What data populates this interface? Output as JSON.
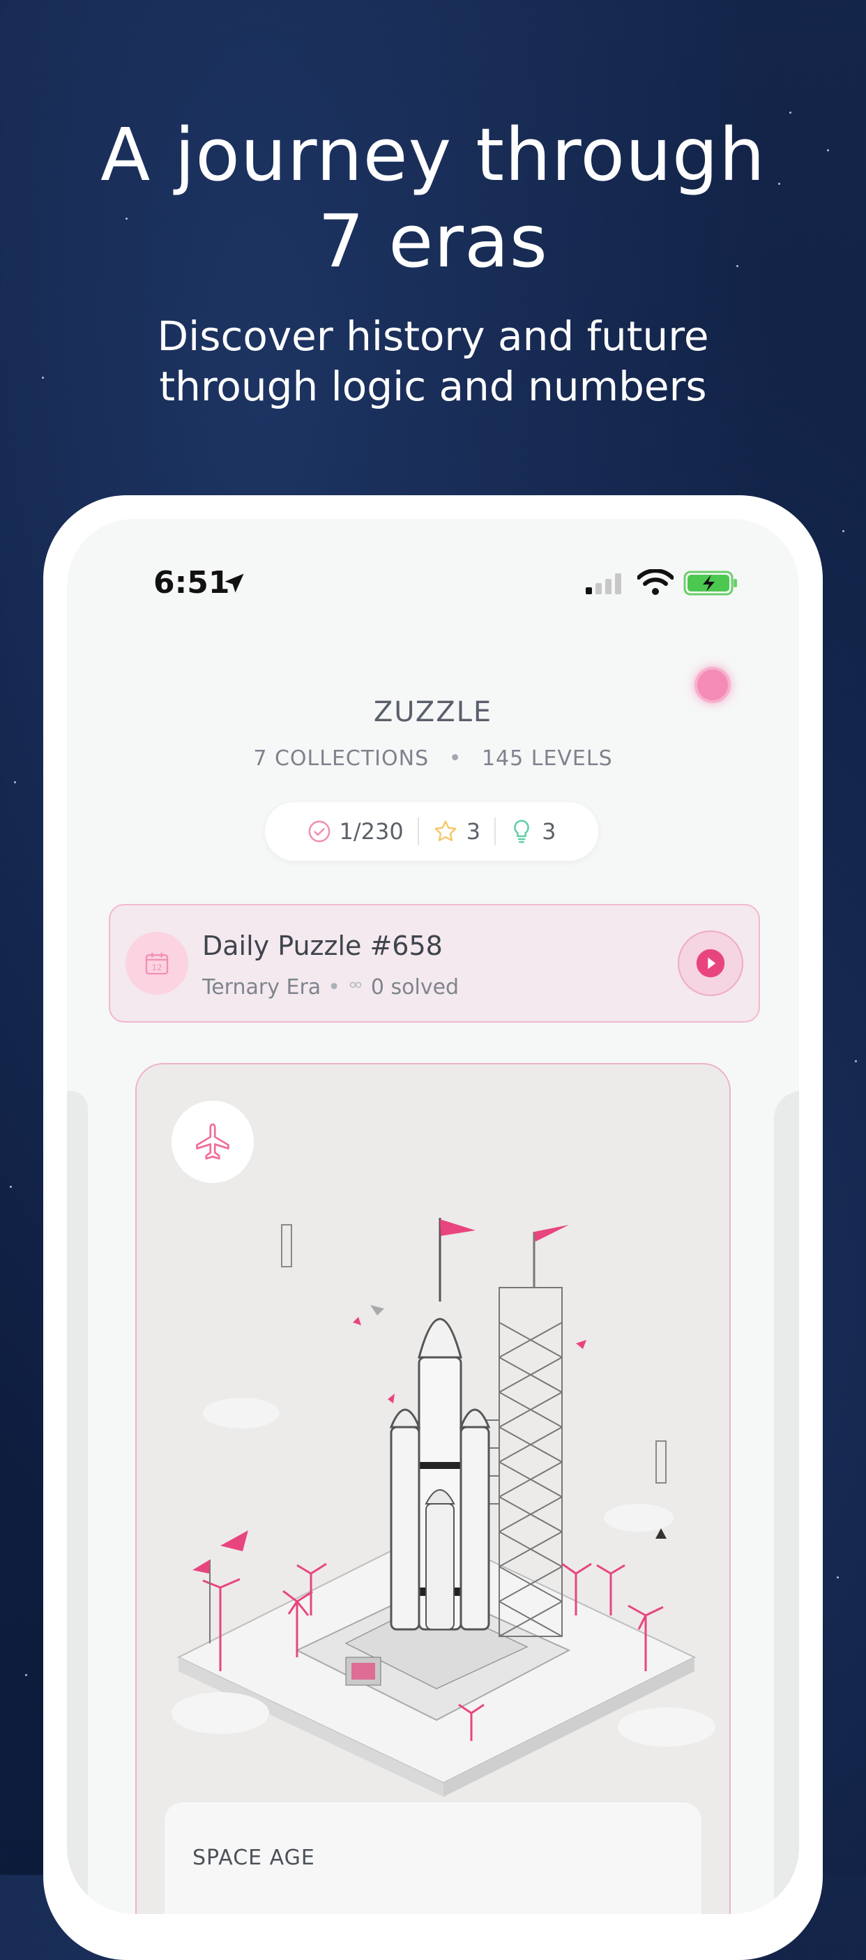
{
  "headline": {
    "line1": "A journey through",
    "line2": "7 eras"
  },
  "subheadline": {
    "line1": "Discover history and future",
    "line2": "through logic and numbers"
  },
  "status_bar": {
    "time": "6:51"
  },
  "app": {
    "title": "ZUZZLE",
    "collections": "7 COLLECTIONS",
    "levels": "145 LEVELS"
  },
  "stats": {
    "progress": "1/230",
    "stars": "3",
    "hints": "3"
  },
  "daily_puzzle": {
    "title": "Daily Puzzle #658",
    "era": "Ternary Era",
    "solved": "0 solved",
    "calendar_day": "12"
  },
  "era_card": {
    "label": "SPACE AGE",
    "icon": "airplane-icon"
  },
  "colors": {
    "accent_pink": "#e8457f",
    "background_navy": "#0f1f42"
  }
}
